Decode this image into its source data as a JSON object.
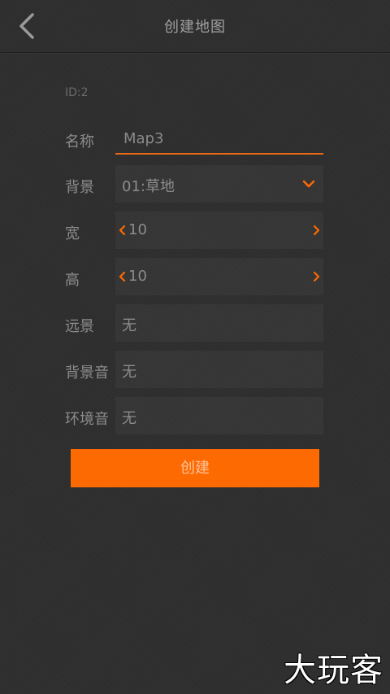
{
  "header": {
    "title": "创建地图"
  },
  "form": {
    "id_text": "ID:2",
    "name": {
      "label": "名称",
      "value": "Map3"
    },
    "background": {
      "label": "背景",
      "value": "01:草地"
    },
    "width": {
      "label": "宽",
      "value": "10"
    },
    "height": {
      "label": "高",
      "value": "10"
    },
    "distant_view": {
      "label": "远景",
      "value": "无"
    },
    "bg_music": {
      "label": "背景音",
      "value": "无"
    },
    "ambient_sound": {
      "label": "环境音",
      "value": "无"
    },
    "create_label": "创建"
  },
  "watermark": "大玩客",
  "colors": {
    "accent": "#fe6a02",
    "background": "#2f2f2f"
  },
  "icons": {
    "back": "chevron-left-icon",
    "dropdown": "chevron-down-icon",
    "stepper_left": "chevron-left-icon",
    "stepper_right": "chevron-right-icon"
  }
}
